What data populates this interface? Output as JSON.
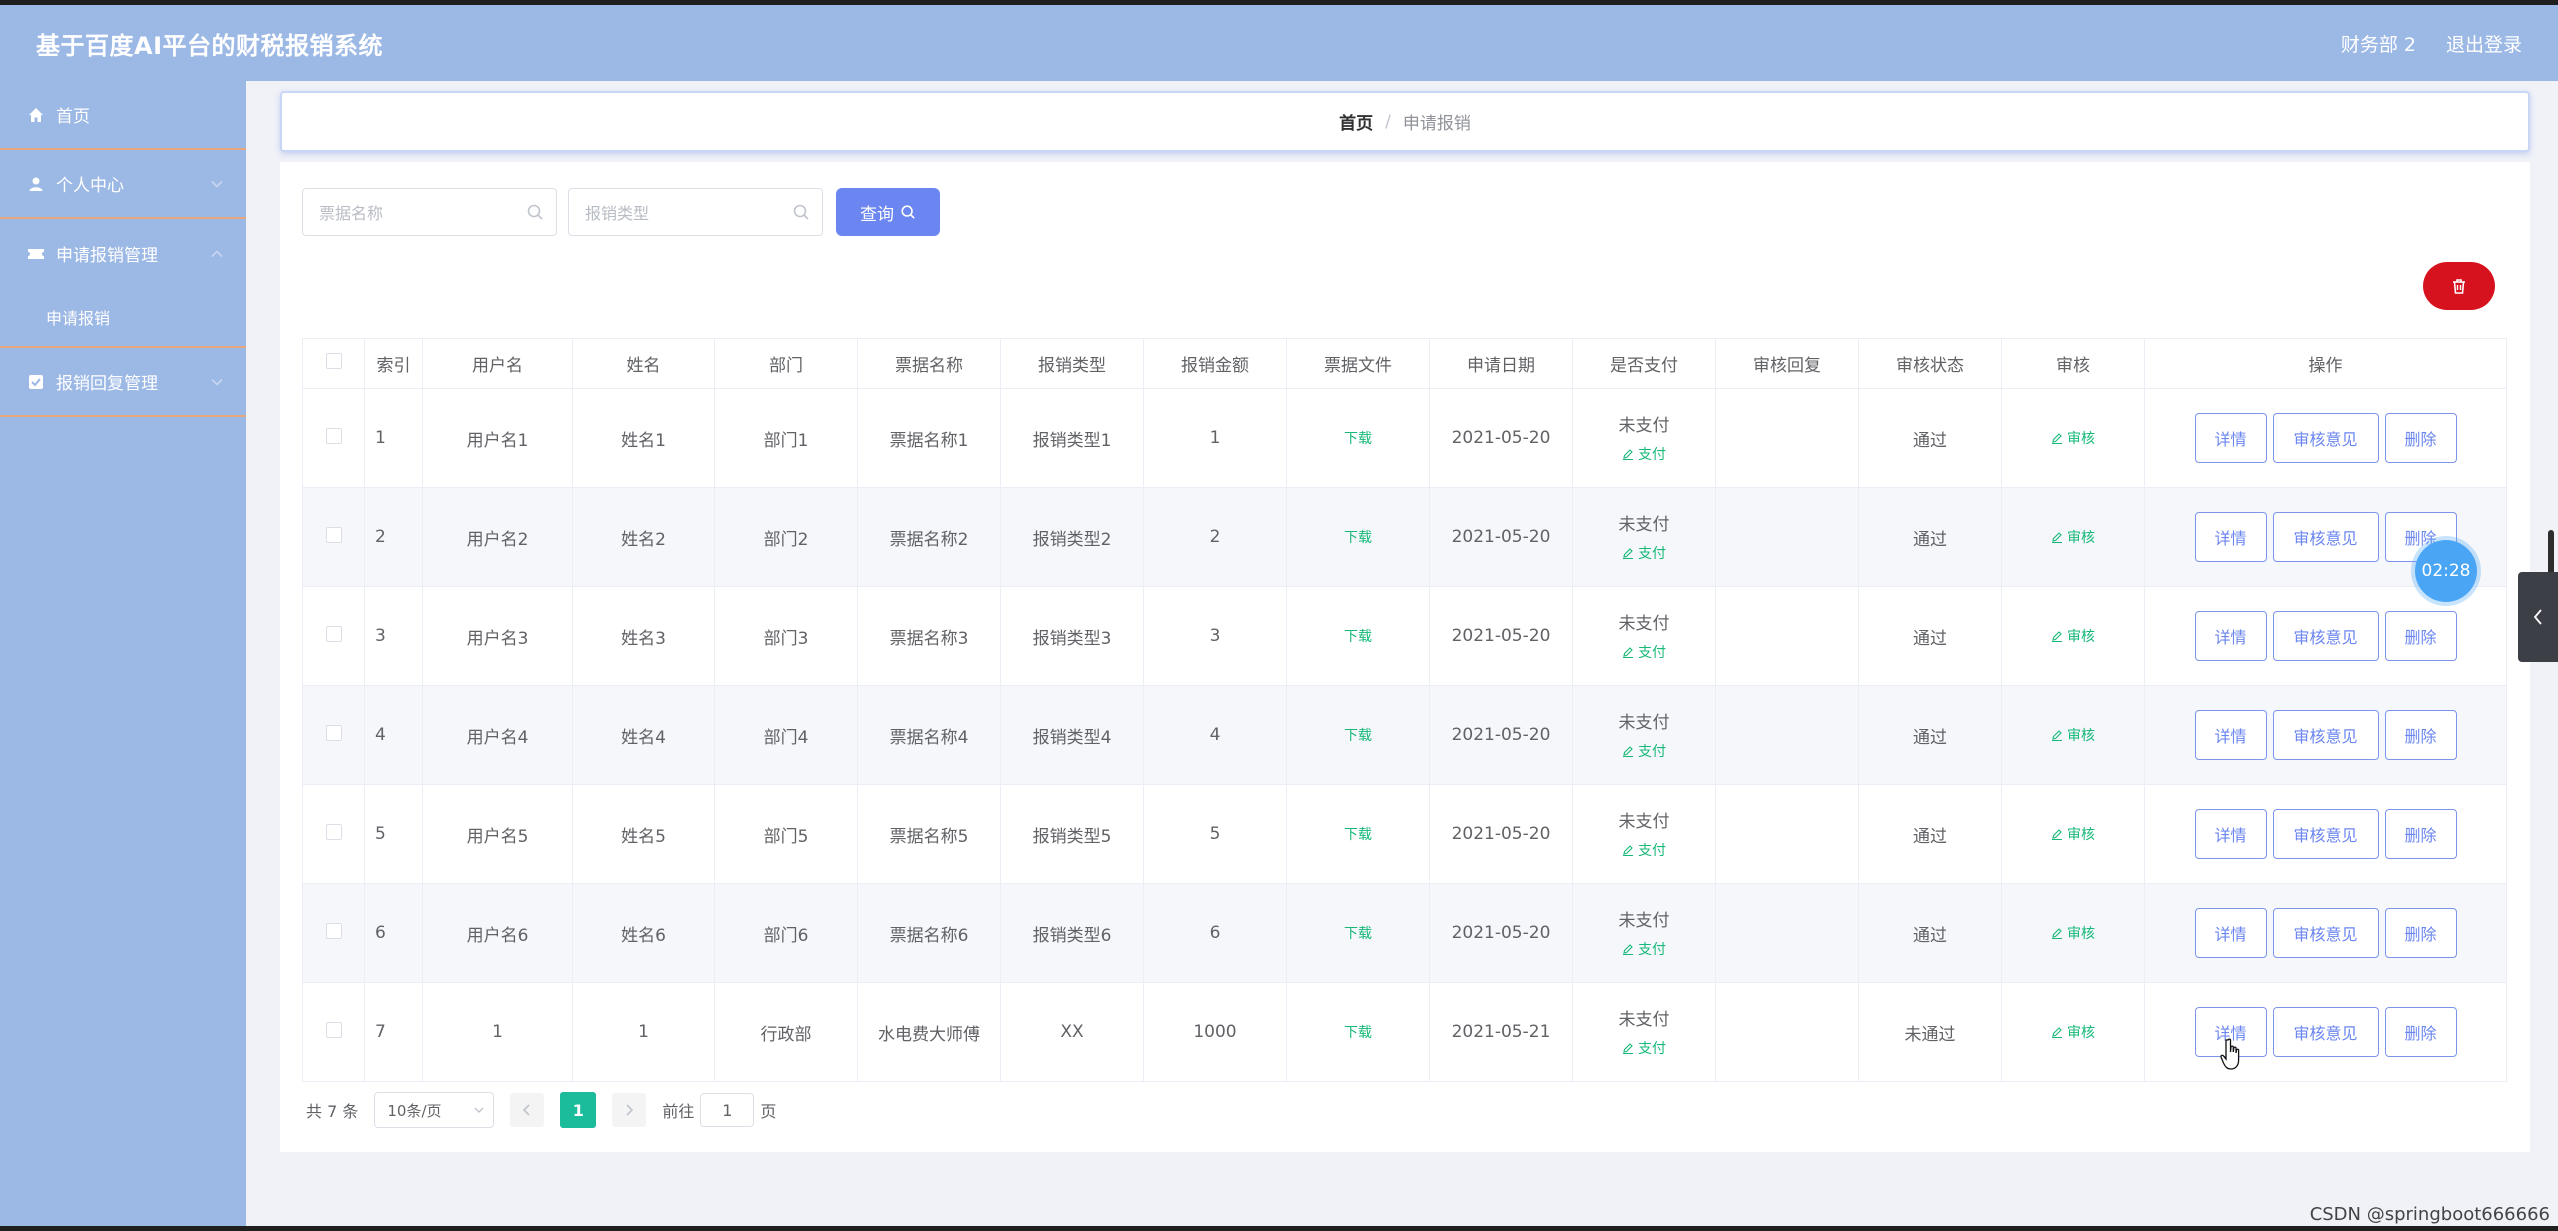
{
  "header": {
    "title": "基于百度AI平台的财税报销系统",
    "user": "财务部 2",
    "logout": "退出登录"
  },
  "sidebar": {
    "items": [
      {
        "label": "首页",
        "icon": "home-icon"
      },
      {
        "label": "个人中心",
        "icon": "user-icon"
      },
      {
        "label": "申请报销管理",
        "icon": "ticket-icon"
      },
      {
        "label": "报销回复管理",
        "icon": "checkbox-icon"
      }
    ],
    "submenu": {
      "label": "申请报销"
    }
  },
  "breadcrumb": {
    "home": "首页",
    "sep": "/",
    "current": "申请报销"
  },
  "search": {
    "bill_name_placeholder": "票据名称",
    "reimburse_type_placeholder": "报销类型",
    "query_label": "查询"
  },
  "table": {
    "headers": [
      "索引",
      "用户名",
      "姓名",
      "部门",
      "票据名称",
      "报销类型",
      "报销金额",
      "票据文件",
      "申请日期",
      "是否支付",
      "审核回复",
      "审核状态",
      "审核",
      "操作"
    ],
    "rows": [
      {
        "idx": "1",
        "username": "用户名1",
        "name": "姓名1",
        "dept": "部门1",
        "bill": "票据名称1",
        "type": "报销类型1",
        "amount": "1",
        "file": "下载",
        "date": "2021-05-20",
        "paid": "未支付",
        "pay": "支付",
        "reply": "",
        "status": "通过",
        "audit": "审核"
      },
      {
        "idx": "2",
        "username": "用户名2",
        "name": "姓名2",
        "dept": "部门2",
        "bill": "票据名称2",
        "type": "报销类型2",
        "amount": "2",
        "file": "下载",
        "date": "2021-05-20",
        "paid": "未支付",
        "pay": "支付",
        "reply": "",
        "status": "通过",
        "audit": "审核"
      },
      {
        "idx": "3",
        "username": "用户名3",
        "name": "姓名3",
        "dept": "部门3",
        "bill": "票据名称3",
        "type": "报销类型3",
        "amount": "3",
        "file": "下载",
        "date": "2021-05-20",
        "paid": "未支付",
        "pay": "支付",
        "reply": "",
        "status": "通过",
        "audit": "审核"
      },
      {
        "idx": "4",
        "username": "用户名4",
        "name": "姓名4",
        "dept": "部门4",
        "bill": "票据名称4",
        "type": "报销类型4",
        "amount": "4",
        "file": "下载",
        "date": "2021-05-20",
        "paid": "未支付",
        "pay": "支付",
        "reply": "",
        "status": "通过",
        "audit": "审核"
      },
      {
        "idx": "5",
        "username": "用户名5",
        "name": "姓名5",
        "dept": "部门5",
        "bill": "票据名称5",
        "type": "报销类型5",
        "amount": "5",
        "file": "下载",
        "date": "2021-05-20",
        "paid": "未支付",
        "pay": "支付",
        "reply": "",
        "status": "通过",
        "audit": "审核"
      },
      {
        "idx": "6",
        "username": "用户名6",
        "name": "姓名6",
        "dept": "部门6",
        "bill": "票据名称6",
        "type": "报销类型6",
        "amount": "6",
        "file": "下载",
        "date": "2021-05-20",
        "paid": "未支付",
        "pay": "支付",
        "reply": "",
        "status": "通过",
        "audit": "审核"
      },
      {
        "idx": "7",
        "username": "1",
        "name": "1",
        "dept": "行政部",
        "bill": "水电费大师傅",
        "type": "XX",
        "amount": "1000",
        "file": "下载",
        "date": "2021-05-21",
        "paid": "未支付",
        "pay": "支付",
        "reply": "",
        "status": "未通过",
        "audit": "审核"
      }
    ],
    "ops": {
      "detail": "详情",
      "opinion": "审核意见",
      "delete": "删除"
    }
  },
  "pagination": {
    "total": "共 7 条",
    "page_size": "10条/页",
    "current": "1",
    "goto_prefix": "前往",
    "goto_value": "1",
    "goto_suffix": "页"
  },
  "timer": "02:28",
  "watermark": "CSDN @springboot666666",
  "colors": {
    "header_bg": "#9cb8e5",
    "primary": "#6b86f0",
    "danger": "#d7121f",
    "success": "#17b978",
    "page_active": "#1bbc9b"
  }
}
